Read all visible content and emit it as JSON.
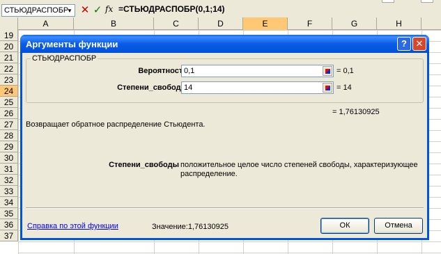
{
  "formula_bar": {
    "name_box": "СТЬЮДРАСПОБР",
    "cancel_glyph": "✕",
    "enter_glyph": "✓",
    "fx_label": "fx",
    "formula": "=СТЬЮДРАСПОБР(0,1;14)"
  },
  "sheet": {
    "columns": [
      "A",
      "B",
      "C",
      "D",
      "E",
      "F",
      "G",
      "H"
    ],
    "selected_column": "E",
    "rows": [
      "19",
      "20",
      "21",
      "22",
      "23",
      "24",
      "25",
      "26",
      "27",
      "28",
      "29",
      "30",
      "31",
      "32",
      "33",
      "34",
      "35",
      "36",
      "37"
    ],
    "selected_row": "24"
  },
  "dialog": {
    "title": "Аргументы функции",
    "help_button": "?",
    "close_button": "✕",
    "function_name": "СТЬЮДРАСПОБР",
    "args": [
      {
        "label": "Вероятность",
        "value": "0,1",
        "result": "= 0,1"
      },
      {
        "label": "Степени_свободы",
        "value": "14",
        "result": "= 14"
      }
    ],
    "total_result": "= 1,76130925",
    "description": "Возвращает обратное распределение Стьюдента.",
    "help_arg_label": "Степени_свободы",
    "help_arg_text": "положительное целое число степеней свободы, характеризующее распределение.",
    "help_link": "Справка по этой функции",
    "value_line": "Значение:1,76130925",
    "ok_label": "ОК",
    "cancel_label": "Отмена"
  },
  "colors": {
    "title_bar": "#0054e3",
    "dialog_face": "#ece9d8",
    "selected_header": "#ffc875",
    "link": "#0000ff"
  }
}
